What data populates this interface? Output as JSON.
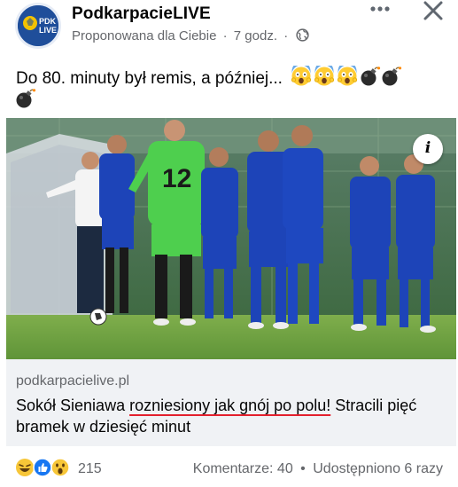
{
  "header": {
    "page_name": "PodkarpacieLIVE",
    "suggested_label": "Proponowana dla Ciebie",
    "separator": "·",
    "time": "7 godz.",
    "time_separator": "·",
    "avatar_text_top": "PDK",
    "avatar_text_bottom": "LIVE",
    "privacy_icon": "globe-icon",
    "more_icon": "more-horizontal-icon",
    "close_icon": "close-icon"
  },
  "post": {
    "caption_text": "Do 80. minuty był remis, a później...",
    "caption_emojis": [
      "face-screaming-emoji",
      "face-screaming-emoji",
      "face-screaming-emoji",
      "bomb-emoji",
      "bomb-emoji",
      "bomb-emoji"
    ]
  },
  "image": {
    "subject": "football-team-photo",
    "goalkeeper_number": "12",
    "info_button_label": "i"
  },
  "link_preview": {
    "domain": "podkarpacielive.pl",
    "title_part1": "Sokół Sieniawa ",
    "title_underlined": "rozniesiony jak gnój po polu!",
    "title_part2": " Stracili pięć bramek w dziesięć minut"
  },
  "footer": {
    "reaction_icons": [
      "haha-reaction-icon",
      "like-reaction-icon",
      "wow-reaction-icon"
    ],
    "reaction_count": "215",
    "comments": "Komentarze: 40",
    "dot": "•",
    "shares": "Udostępniono 6 razy"
  },
  "colors": {
    "brand_blue": "#1f4e9a",
    "secondary_text": "#65676b",
    "link_background": "#f0f2f5",
    "underline_red": "#e4202d"
  }
}
